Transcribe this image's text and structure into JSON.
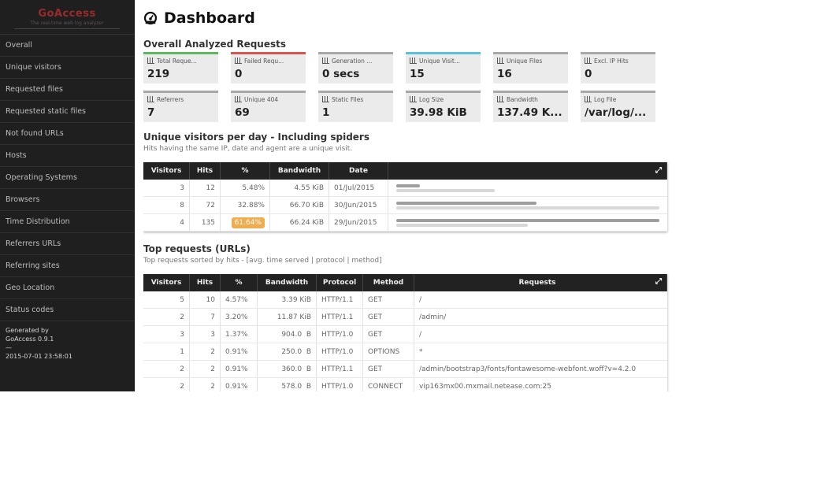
{
  "sidebar": {
    "brand": "GoAccess",
    "tagline": "The real-time web log analyzer",
    "items": [
      "Overall",
      "Unique visitors",
      "Requested files",
      "Requested static files",
      "Not found URLs",
      "Hosts",
      "Operating Systems",
      "Browsers",
      "Time Distribution",
      "Referrers URLs",
      "Referring sites",
      "Geo Location",
      "Status codes"
    ],
    "generated_by": "Generated by",
    "version": "GoAccess 0.9.1",
    "separator": "—",
    "timestamp": "2015-07-01 23:58:01"
  },
  "header": {
    "title": "Dashboard",
    "icon": "dashboard-icon"
  },
  "overall": {
    "title": "Overall Analyzed Requests",
    "cards": [
      {
        "label": "Total Reque...",
        "value": "219",
        "accent": "#5cb85c"
      },
      {
        "label": "Failed Requ...",
        "value": "0",
        "accent": "#d9534f"
      },
      {
        "label": "Generation ...",
        "value": "0 secs",
        "accent": "#a8a8a8"
      },
      {
        "label": "Unique Visit...",
        "value": "15",
        "accent": "#5bc0de"
      },
      {
        "label": "Unique Files",
        "value": "16",
        "accent": "#a8a8a8"
      },
      {
        "label": "Excl. IP Hits",
        "value": "0",
        "accent": "#a8a8a8"
      },
      {
        "label": "Referrers",
        "value": "7",
        "accent": "#a8a8a8"
      },
      {
        "label": "Unique 404",
        "value": "69",
        "accent": "#a8a8a8"
      },
      {
        "label": "Static Files",
        "value": "1",
        "accent": "#a8a8a8"
      },
      {
        "label": "Log Size",
        "value": "39.98 KiB",
        "accent": "#a8a8a8"
      },
      {
        "label": "Bandwidth",
        "value": "137.49 K...",
        "accent": "#a8a8a8"
      },
      {
        "label": "Log File",
        "value": "/var/log/...",
        "accent": "#a8a8a8"
      }
    ]
  },
  "visitors": {
    "title": "Unique visitors per day - Including spiders",
    "subtitle": "Hits having the same IP, date and agent are a unique visit.",
    "columns": [
      "Visitors",
      "Hits",
      "%",
      "Bandwidth",
      "Date"
    ],
    "rows": [
      {
        "visitors": "3",
        "hits": "12",
        "pct": "5.48%",
        "bw": "4.55 KiB",
        "date": "01/Jul/2015",
        "hits_ratio": 0.089,
        "visitors_ratio": 0.375,
        "highlight": false
      },
      {
        "visitors": "8",
        "hits": "72",
        "pct": "32.88%",
        "bw": "66.70 KiB",
        "date": "30/Jun/2015",
        "hits_ratio": 0.533,
        "visitors_ratio": 1.0,
        "highlight": false
      },
      {
        "visitors": "4",
        "hits": "135",
        "pct": "61.64%",
        "bw": "66.24 KiB",
        "date": "29/Jun/2015",
        "hits_ratio": 1.0,
        "visitors_ratio": 0.5,
        "highlight": true
      }
    ]
  },
  "requests": {
    "title": "Top requests (URLs)",
    "subtitle": "Top requests sorted by hits - [avg. time served | protocol | method]",
    "columns": [
      "Visitors",
      "Hits",
      "%",
      "Bandwidth",
      "Protocol",
      "Method",
      "Requests"
    ],
    "rows": [
      {
        "visitors": "5",
        "hits": "10",
        "pct": "4.57%",
        "bw": "3.39 KiB",
        "protocol": "HTTP/1.1",
        "method": "GET",
        "request": "/"
      },
      {
        "visitors": "2",
        "hits": "7",
        "pct": "3.20%",
        "bw": "11.87 KiB",
        "protocol": "HTTP/1.1",
        "method": "GET",
        "request": "/admin/"
      },
      {
        "visitors": "3",
        "hits": "3",
        "pct": "1.37%",
        "bw": "904.0  B",
        "protocol": "HTTP/1.0",
        "method": "GET",
        "request": "/"
      },
      {
        "visitors": "1",
        "hits": "2",
        "pct": "0.91%",
        "bw": "250.0  B",
        "protocol": "HTTP/1.0",
        "method": "OPTIONS",
        "request": "*"
      },
      {
        "visitors": "2",
        "hits": "2",
        "pct": "0.91%",
        "bw": "360.0  B",
        "protocol": "HTTP/1.1",
        "method": "GET",
        "request": "/admin/bootstrap3/fonts/fontawesome-webfont.woff?v=4.2.0"
      },
      {
        "visitors": "2",
        "hits": "2",
        "pct": "0.91%",
        "bw": "578.0  B",
        "protocol": "HTTP/1.0",
        "method": "CONNECT",
        "request": "vip163mx00.mxmail.netease.com:25"
      }
    ]
  }
}
